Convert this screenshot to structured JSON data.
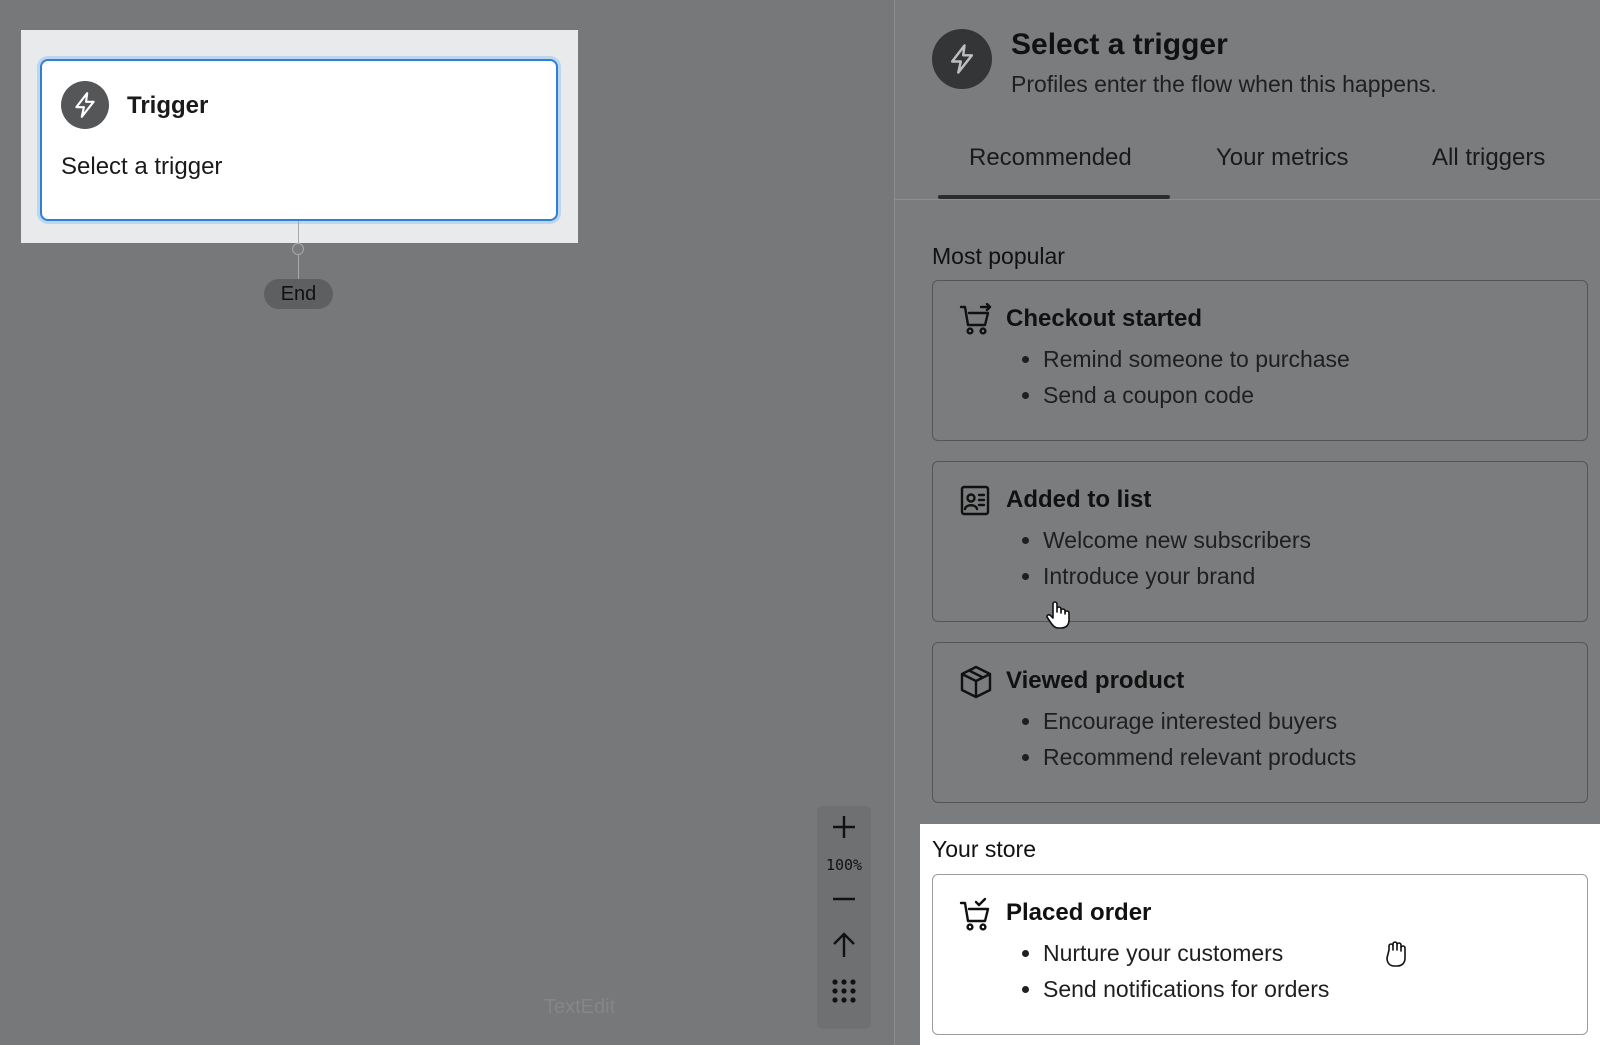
{
  "canvas": {
    "trigger_node": {
      "title": "Trigger",
      "subtitle": "Select a trigger",
      "icon": "lightning-icon"
    },
    "end_label": "End",
    "zoom": {
      "zoom_in_icon": "plus-icon",
      "level": "100%",
      "zoom_out_icon": "minus-icon",
      "reset_icon": "arrow-up-icon",
      "grid_icon": "grid-dots-icon"
    },
    "ghost_text": "TextEdit"
  },
  "panel": {
    "icon": "lightning-icon",
    "title": "Select a trigger",
    "subtitle": "Profiles enter the flow when this happens.",
    "tabs": [
      {
        "label": "Recommended",
        "active": true
      },
      {
        "label": "Your metrics",
        "active": false
      },
      {
        "label": "All triggers",
        "active": false
      }
    ],
    "sections": {
      "popular_label": "Most popular",
      "store_label": "Your store"
    },
    "options": [
      {
        "icon": "cart-arrow-icon",
        "title": "Checkout started",
        "bullets": [
          "Remind someone to purchase",
          "Send a coupon code"
        ]
      },
      {
        "icon": "contact-list-icon",
        "title": "Added to list",
        "bullets": [
          "Welcome new subscribers",
          "Introduce your brand"
        ]
      },
      {
        "icon": "box-icon",
        "title": "Viewed product",
        "bullets": [
          "Encourage interested buyers",
          "Recommend relevant products"
        ]
      },
      {
        "icon": "cart-check-icon",
        "title": "Placed order",
        "bullets": [
          "Nurture your customers",
          "Send notifications for orders"
        ]
      }
    ]
  },
  "colors": {
    "accent_border": "#2f7fd3",
    "overlay": "#7b7c7d"
  }
}
